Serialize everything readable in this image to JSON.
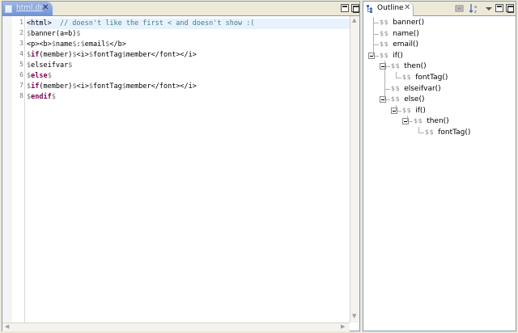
{
  "editor": {
    "tab_label": "html.dr",
    "tab_close": "✕",
    "line_numbers": [
      "1",
      "2",
      "3",
      "4",
      "5",
      "6",
      "7",
      "8"
    ],
    "lines": [
      [
        [
          "tag",
          "<html>"
        ],
        [
          "comment",
          "  // doesn't like the first < and doesn't show :("
        ]
      ],
      [
        [
          "dollar",
          "$"
        ],
        [
          "var",
          "banner(a=b)"
        ],
        [
          "dollar",
          "$"
        ]
      ],
      [
        [
          "tag",
          "<p><b>"
        ],
        [
          "dollar",
          "$"
        ],
        [
          "var",
          "name"
        ],
        [
          "dollar",
          "$"
        ],
        [
          "tag",
          ":"
        ],
        [
          "dollar",
          "$"
        ],
        [
          "var",
          "email"
        ],
        [
          "dollar",
          "$"
        ],
        [
          "tag",
          "</b>"
        ]
      ],
      [
        [
          "dollar",
          "$"
        ],
        [
          "kw",
          "if"
        ],
        [
          "var",
          "(member)"
        ],
        [
          "dollar",
          "$"
        ],
        [
          "tag",
          "<i>"
        ],
        [
          "dollar",
          "$"
        ],
        [
          "var",
          "fontTag"
        ],
        [
          "dollar",
          "$"
        ],
        [
          "var",
          "member"
        ],
        [
          "tag",
          "</font></i>"
        ]
      ],
      [
        [
          "dollar",
          "$"
        ],
        [
          "var",
          "elseifvar"
        ],
        [
          "dollar",
          "$"
        ]
      ],
      [
        [
          "dollar",
          "$"
        ],
        [
          "kw",
          "else"
        ],
        [
          "dollar",
          "$"
        ]
      ],
      [
        [
          "dollar",
          "$"
        ],
        [
          "kw",
          "if"
        ],
        [
          "var",
          "(member)"
        ],
        [
          "dollar",
          "$"
        ],
        [
          "tag",
          "<i>"
        ],
        [
          "dollar",
          "$"
        ],
        [
          "var",
          "fontTag"
        ],
        [
          "dollar",
          "$"
        ],
        [
          "var",
          "member"
        ],
        [
          "tag",
          "</font></i>"
        ]
      ],
      [
        [
          "dollar",
          "$"
        ],
        [
          "kw",
          "endif"
        ],
        [
          "dollar",
          "$"
        ]
      ]
    ]
  },
  "outline": {
    "tab_label": "Outline",
    "tab_close": "✕",
    "node_prefix": "$$",
    "nodes": [
      {
        "label": "banner()",
        "depth": 0,
        "expandable": false
      },
      {
        "label": "name()",
        "depth": 0,
        "expandable": false
      },
      {
        "label": "email()",
        "depth": 0,
        "expandable": false
      },
      {
        "label": "if()",
        "depth": 0,
        "expandable": true
      },
      {
        "label": "then()",
        "depth": 1,
        "expandable": true
      },
      {
        "label": "fontTag()",
        "depth": 2,
        "expandable": false
      },
      {
        "label": "elseifvar()",
        "depth": 1,
        "expandable": false
      },
      {
        "label": "else()",
        "depth": 1,
        "expandable": true
      },
      {
        "label": "if()",
        "depth": 2,
        "expandable": true
      },
      {
        "label": "then()",
        "depth": 3,
        "expandable": true
      },
      {
        "label": "fontTag()",
        "depth": 4,
        "expandable": false
      }
    ]
  },
  "icons": {
    "editor_tab": "html-file-icon",
    "outline_tab": "outline-icon",
    "toolbar": [
      "hide-fields-icon",
      "sort-alpha-icon",
      "view-menu-icon"
    ]
  },
  "colors": {
    "comment": "#3f7f7f",
    "keyword": "#7f0055",
    "dollar": "#7a7a7a",
    "current_line": "#e8f2fe",
    "active_tab": "#7f9fd8"
  }
}
